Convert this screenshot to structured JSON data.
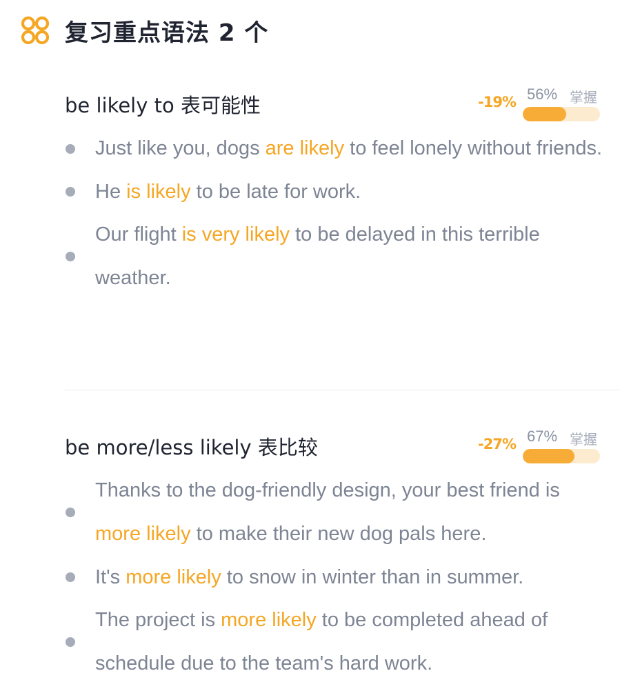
{
  "header": {
    "title": "复习重点语法 2 个",
    "icon": "clover-logo-icon",
    "accent_color": "#f5a623"
  },
  "grammar": [
    {
      "title": "be likely to 表可能性",
      "delta": "-19%",
      "percent": "56%",
      "percent_value": 56,
      "mastery_label": "掌握",
      "examples": [
        {
          "before": "Just like you, dogs ",
          "highlight": "are likely",
          "after": " to feel lonely without friends."
        },
        {
          "before": "He ",
          "highlight": "is likely",
          "after": " to be late for work."
        },
        {
          "before": "Our flight ",
          "highlight": "is very likely",
          "after": " to be delayed in this terrible weather."
        }
      ]
    },
    {
      "title": "be more/less likely 表比较",
      "delta": "-27%",
      "percent": "67%",
      "percent_value": 67,
      "mastery_label": "掌握",
      "examples": [
        {
          "before": "Thanks to the dog-friendly design, your best friend is ",
          "highlight": "more likely",
          "after": " to make their new dog pals here."
        },
        {
          "before": "It's ",
          "highlight": "more likely",
          "after": " to snow in winter than in summer."
        },
        {
          "before": "The project is ",
          "highlight": "more likely",
          "after": " to be completed ahead of schedule due to the team's hard work."
        }
      ]
    }
  ],
  "colors": {
    "title_text": "#1f2430",
    "example_text": "#7d8493",
    "highlight": "#f5a623",
    "bar_fill": "#f7ac37",
    "bar_track": "#fdebcf",
    "bullet": "#a6acb8"
  }
}
